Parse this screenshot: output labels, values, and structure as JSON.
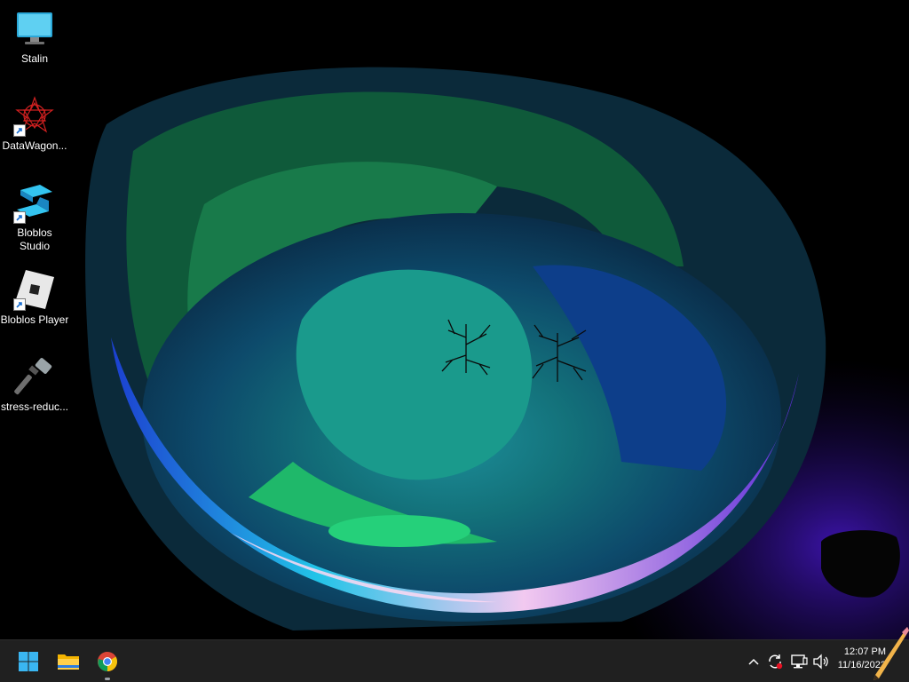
{
  "desktop": {
    "icons": [
      {
        "label": "Stalin",
        "icon": "monitor-icon",
        "shortcut": false
      },
      {
        "label": "DataWagon...",
        "icon": "datawagon-icon",
        "shortcut": true
      },
      {
        "label": "Bloblos\nStudio",
        "icon": "bloblos-studio-icon",
        "shortcut": true
      },
      {
        "label": "Bloblos Player",
        "icon": "bloblos-player-icon",
        "shortcut": true
      },
      {
        "label": "stress-reduc...",
        "icon": "hammer-icon",
        "shortcut": false
      }
    ]
  },
  "taskbar": {
    "pinned": [
      {
        "name": "start-button",
        "icon": "windows-icon"
      },
      {
        "name": "file-explorer-button",
        "icon": "folder-icon"
      },
      {
        "name": "chrome-button",
        "icon": "chrome-icon",
        "running": true
      }
    ],
    "tray": [
      "chevron-up-icon",
      "sync-icon",
      "network-icon",
      "volume-icon"
    ],
    "clock": {
      "time": "12:07 PM",
      "date": "11/16/2022"
    }
  },
  "colors": {
    "taskbar": "#202020",
    "accent": "#0078d4"
  }
}
